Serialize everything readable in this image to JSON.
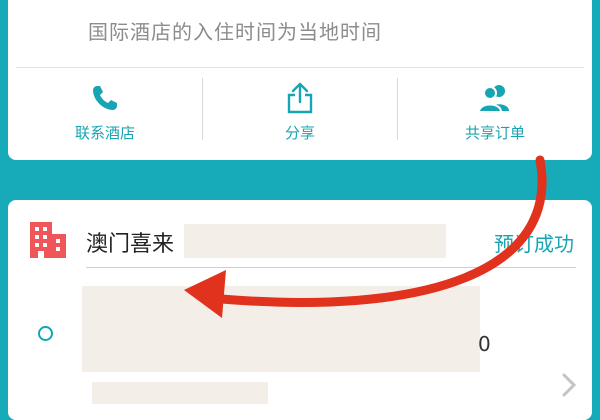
{
  "top_card": {
    "notice": "国际酒店的入住时间为当地时间",
    "actions": [
      {
        "label": "联系酒店",
        "icon": "phone-icon"
      },
      {
        "label": "分享",
        "icon": "share-icon"
      },
      {
        "label": "共享订单",
        "icon": "users-icon"
      }
    ]
  },
  "order_card": {
    "hotel_name": "澳门喜来",
    "status": "预订成功",
    "detail_fragment": "0",
    "icon": "building-icon"
  },
  "colors": {
    "accent": "#17a5b3",
    "background": "#17aab8",
    "hotel_icon": "#f0555a",
    "annotation_arrow": "#e0321c"
  }
}
